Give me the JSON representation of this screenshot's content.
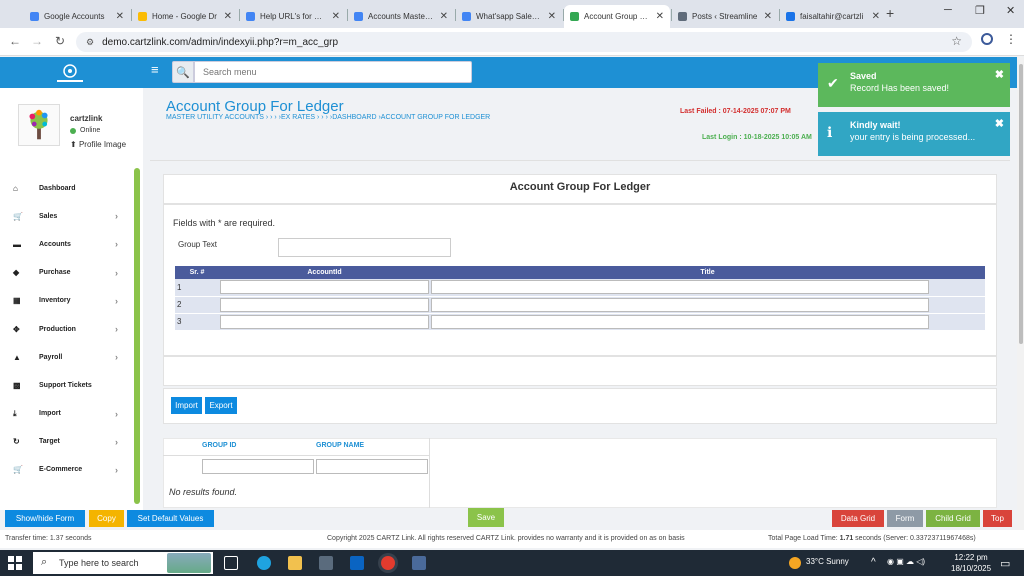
{
  "browser": {
    "tabs": [
      {
        "title": "Google Accounts",
        "color": "#4285f4"
      },
      {
        "title": "Home - Google Dr",
        "color": "#fbbc04"
      },
      {
        "title": "Help URL's for ERP",
        "color": "#4285f4"
      },
      {
        "title": "Accounts Master D",
        "color": "#4285f4"
      },
      {
        "title": "What'sapp Sales M",
        "color": "#4285f4"
      },
      {
        "title": "Account Group For",
        "color": "#34a853"
      },
      {
        "title": "Posts ‹ Streamline",
        "color": "#5f6b7a"
      },
      {
        "title": "faisaltahir@cartzli",
        "color": "#1a73e8"
      }
    ],
    "url": "demo.cartzlink.com/admin/indexyii.php?r=m_acc_grp"
  },
  "header": {
    "search_placeholder": "Search menu"
  },
  "user": {
    "name": "cartzlink",
    "status": "Online",
    "profile_label": "Profile Image"
  },
  "menu": [
    {
      "label": "Dashboard",
      "icon": "home-icon",
      "glyph": "⌂",
      "chev": ""
    },
    {
      "label": "Sales",
      "icon": "cart-icon",
      "glyph": "🛒",
      "chev": "›"
    },
    {
      "label": "Accounts",
      "icon": "briefcase-icon",
      "glyph": "▬",
      "chev": "›"
    },
    {
      "label": "Purchase",
      "icon": "tag-icon",
      "glyph": "◆",
      "chev": "›"
    },
    {
      "label": "Inventory",
      "icon": "grid-icon",
      "glyph": "▦",
      "chev": "›"
    },
    {
      "label": "Production",
      "icon": "move-icon",
      "glyph": "✥",
      "chev": "›"
    },
    {
      "label": "Payroll",
      "icon": "bank-icon",
      "glyph": "▲",
      "chev": "›"
    },
    {
      "label": "Support Tickets",
      "icon": "ticket-icon",
      "glyph": "▩",
      "chev": ""
    },
    {
      "label": "Import",
      "icon": "import-icon",
      "glyph": "⤓",
      "chev": "›"
    },
    {
      "label": "Target",
      "icon": "refresh-icon",
      "glyph": "↻",
      "chev": "›"
    },
    {
      "label": "E-Commerce",
      "icon": "cart-icon",
      "glyph": "🛒",
      "chev": "›"
    }
  ],
  "page": {
    "title": "Account Group For Ledger",
    "breadcrumb": "MASTER UTILITY ACCOUNTS  ›  ›  ›  ›EX RATES  ›  ›  ›  ›DASHBOARD  ›ACCOUNT GROUP FOR LEDGER",
    "last_failed": "Last Failed : 07-14-2025 07:07 PM",
    "last_login": "Last Login : 10-18-2025 10:05 AM"
  },
  "form": {
    "panel_title": "Account Group For Ledger",
    "required_note": "Fields with * are required.",
    "group_text_label": "Group Text",
    "group_text_value": "",
    "columns": [
      "Sr. #",
      "AccountId",
      "Title"
    ],
    "rows": [
      {
        "sr": "1",
        "account_id": "",
        "title": ""
      },
      {
        "sr": "2",
        "account_id": "",
        "title": ""
      },
      {
        "sr": "3",
        "account_id": "",
        "title": ""
      }
    ],
    "import_label": "Import",
    "export_label": "Export"
  },
  "lower_grid": {
    "columns": [
      "GROUP ID",
      "GROUP NAME"
    ],
    "empty_text": "No results found."
  },
  "footer_buttons": {
    "show_hide": "Show/hide Form",
    "copy": "Copy",
    "set_default": "Set Default Values",
    "save": "Save",
    "data_grid": "Data Grid",
    "form": "Form",
    "child_grid": "Child Grid",
    "top": "Top"
  },
  "footer": {
    "transfer": "Transfer time: 1.37 seconds",
    "copyright": "Copyright 2025 CARTZ Link. All rights reserved CARTZ Link. provides no warranty and it is provided on as on basis",
    "load_prefix": "Total Page Load Time: ",
    "load_value": "1.71",
    "load_suffix": " seconds (Server: 0.33723711967468s)"
  },
  "toasts": [
    {
      "title": "Saved",
      "message": "Record Has been saved!",
      "color": "#5cb85c"
    },
    {
      "title": "Kindly wait!",
      "message": "your entry is being processed...",
      "color": "#31a6c4"
    }
  ],
  "taskbar": {
    "search_placeholder": "Type here to search",
    "weather": "33°C  Sunny",
    "time": "12:22 pm",
    "date": "18/10/2025"
  }
}
